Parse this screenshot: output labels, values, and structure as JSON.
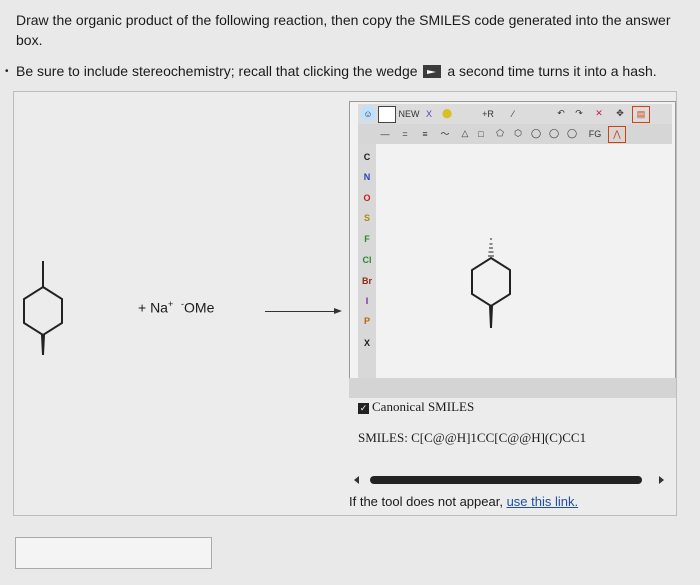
{
  "question": {
    "line1": "Draw the organic product of the following reaction, then copy the SMILES code generated into the answer box.",
    "bullet_pre": "Be sure to include stereochemistry; recall that clicking the wedge",
    "bullet_post": "a second time turns it into a hash."
  },
  "reaction": {
    "reagent": "+ Na",
    "charge_plus": "+",
    "charge_minus": "-",
    "reagent_end": "OMe"
  },
  "editor": {
    "toolbar1": [
      "NEW",
      "X",
      "⬤",
      "+R",
      "⁄",
      "↶",
      "↷",
      "✕",
      "✥",
      "▤"
    ],
    "toolbar2": [
      "—",
      "=",
      "≡",
      "〜",
      "△",
      "□",
      "⬠",
      "⬡",
      "◯",
      "◯",
      "◯",
      "FG",
      "⋀"
    ],
    "atoms": [
      "C",
      "N",
      "O",
      "S",
      "F",
      "Cl",
      "Br",
      "I",
      "P",
      "X"
    ],
    "canonical_label": "Canonical SMILES",
    "checkbox": "✓",
    "smiles_text": "SMILES: C[C@@H]1CC[C@@H](C)CC1",
    "notice_pre": "If the tool does not appear, ",
    "notice_link": "use this link."
  },
  "answer_box": {
    "value": ""
  },
  "colors": {
    "atom_C": "#222222",
    "atom_N": "#2a3fb8",
    "atom_O": "#c02020",
    "atom_S": "#b08a00",
    "atom_F": "#2a8a2a",
    "atom_Cl": "#2a8a2a",
    "atom_Br": "#8a2a10",
    "atom_I": "#7a2aa0",
    "atom_P": "#c06000",
    "atom_X": "#333333"
  }
}
